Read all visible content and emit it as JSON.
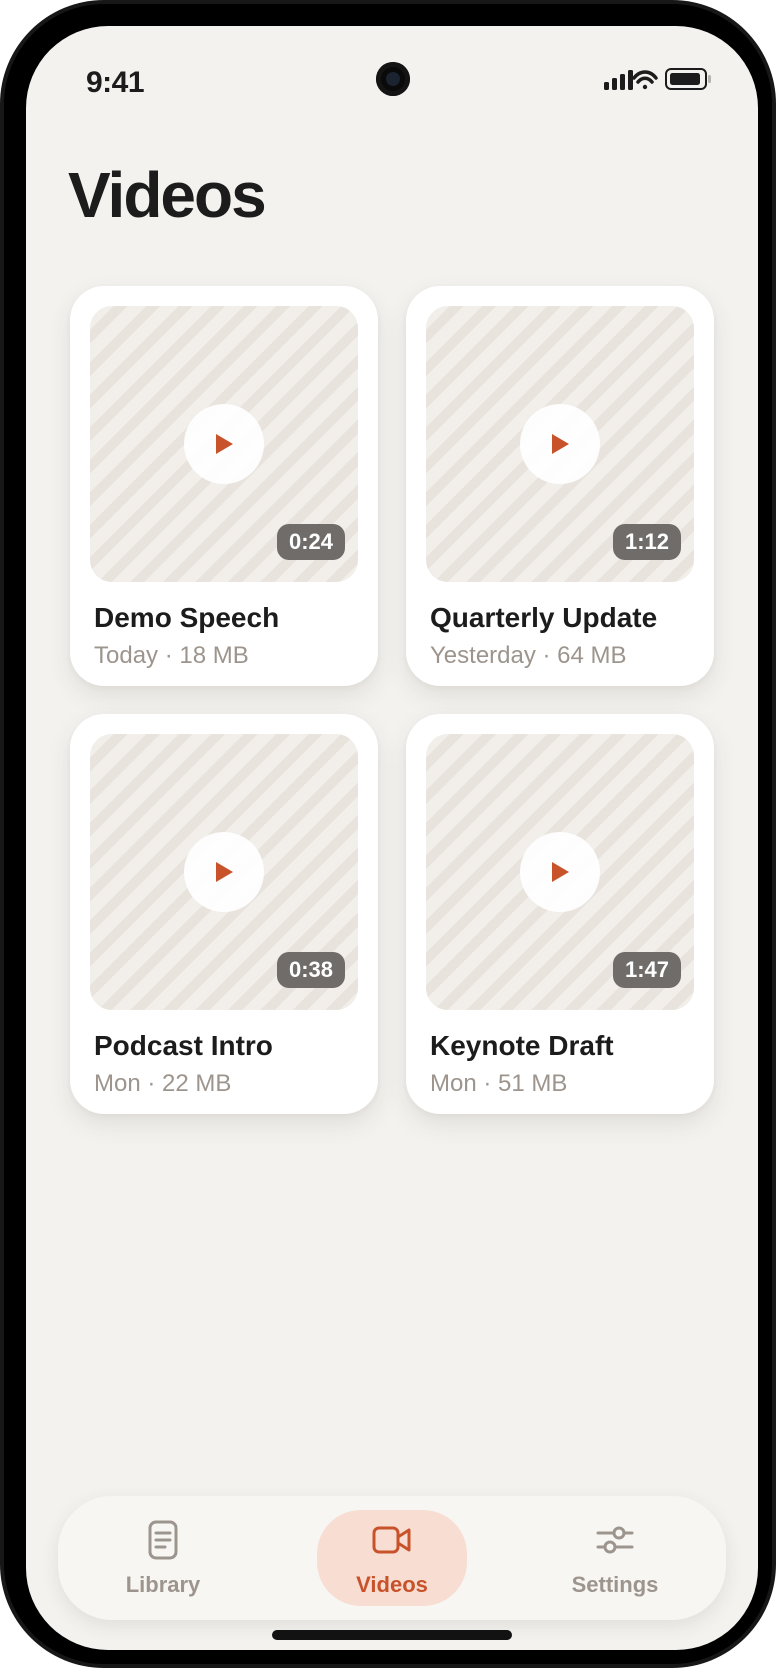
{
  "status_bar": {
    "time": "9:41"
  },
  "page": {
    "title": "Videos"
  },
  "videos": [
    {
      "title": "Demo Speech",
      "meta": "Today · 18 MB",
      "duration": "0:24"
    },
    {
      "title": "Quarterly Update",
      "meta": "Yesterday · 64 MB",
      "duration": "1:12"
    },
    {
      "title": "Podcast Intro",
      "meta": "Mon · 22 MB",
      "duration": "0:38"
    },
    {
      "title": "Keynote Draft",
      "meta": "Mon · 51 MB",
      "duration": "1:47"
    }
  ],
  "tabbar": {
    "items": [
      {
        "label": "Library",
        "icon": "document-icon",
        "active": false
      },
      {
        "label": "Videos",
        "icon": "video-camera-icon",
        "active": true
      },
      {
        "label": "Settings",
        "icon": "sliders-icon",
        "active": false
      }
    ]
  },
  "colors": {
    "accent": "#c8532b",
    "background": "#f3f2ef",
    "card": "#ffffff",
    "muted_text": "#9d958d",
    "duration_badge": "#6f6c69",
    "active_tab_bg": "#f7ddd2"
  }
}
